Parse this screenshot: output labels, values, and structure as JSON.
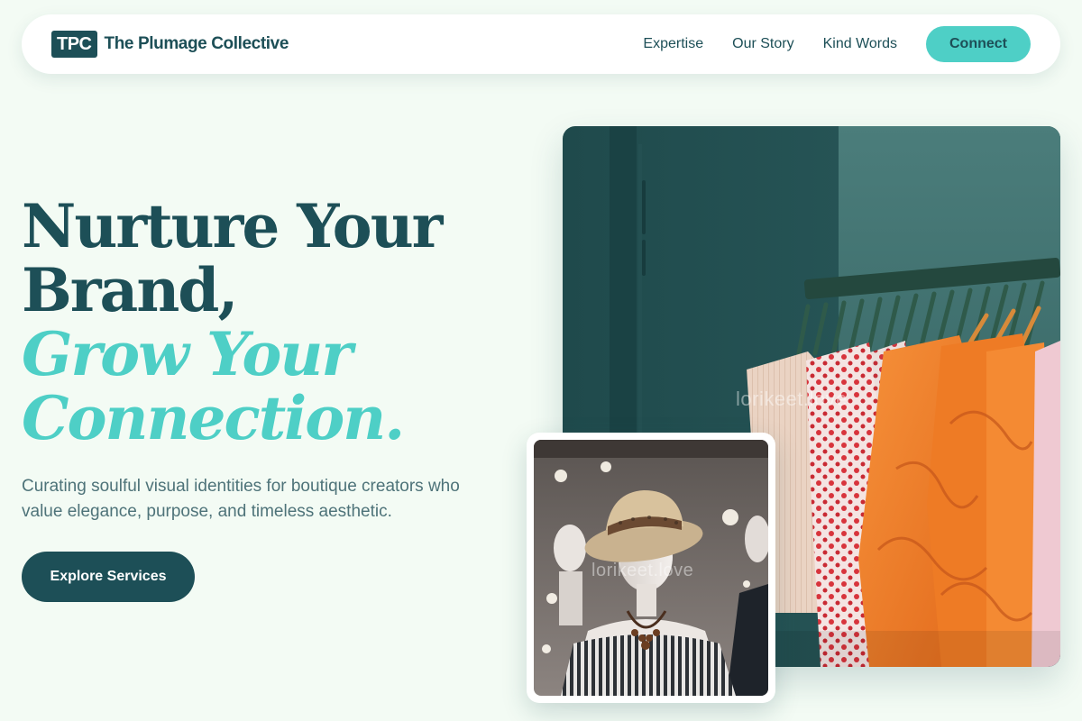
{
  "nav": {
    "logo_mark": "TPC",
    "brand_name": "The Plumage Collective",
    "links": [
      "Expertise",
      "Our Story",
      "Kind Words"
    ],
    "cta_label": "Connect"
  },
  "hero": {
    "headline_line1": "Nurture Your",
    "headline_line2": "Brand,",
    "headline_line3": "Grow Your",
    "headline_line4": "Connection.",
    "subtitle": "Curating soulful visual identities for boutique creators who value elegance, purpose, and timeless aesthetic.",
    "cta_label": "Explore Services"
  },
  "images": {
    "watermark": "lorikeet.love"
  },
  "colors": {
    "primary": "#1d4f57",
    "accent": "#4ecfc6",
    "background": "#f3fbf4"
  }
}
